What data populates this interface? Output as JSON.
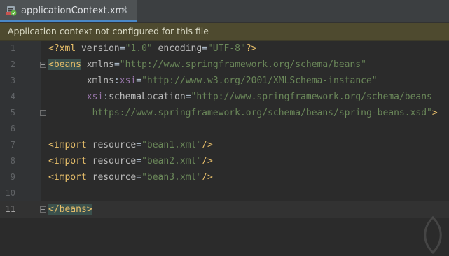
{
  "tab": {
    "label": "applicationContext.xml",
    "close": "✕"
  },
  "banner": {
    "text": "Application context not configured for this file"
  },
  "editor": {
    "current_line": 11,
    "lines": [
      {
        "num": "1"
      },
      {
        "num": "2"
      },
      {
        "num": "3"
      },
      {
        "num": "4"
      },
      {
        "num": "5"
      },
      {
        "num": "6"
      },
      {
        "num": "7"
      },
      {
        "num": "8"
      },
      {
        "num": "9"
      },
      {
        "num": "10"
      },
      {
        "num": "11"
      }
    ],
    "code": {
      "l1": {
        "open": "<?xml",
        "a1": " version",
        "eq1": "=",
        "v1": "\"1.0\"",
        "a2": " encoding",
        "eq2": "=",
        "v2": "\"UTF-8\"",
        "close": "?>"
      },
      "l2": {
        "open": "<beans",
        "a1": " xmlns",
        "eq": "=",
        "v": "\"http://www.springframework.org/schema/beans\""
      },
      "l3": {
        "indent": "       ",
        "a1": "xmlns",
        "colon": ":",
        "ns": "xsi",
        "eq": "=",
        "v": "\"http://www.w3.org/2001/XMLSchema-instance\""
      },
      "l4": {
        "indent": "       ",
        "ns": "xsi",
        "colon": ":",
        "a1": "schemaLocation",
        "eq": "=",
        "v": "\"http://www.springframework.org/schema/beans"
      },
      "l5": {
        "indent": "        ",
        "v": "https://www.springframework.org/schema/beans/spring-beans.xsd\"",
        "close": ">"
      },
      "l7": {
        "open": "<import",
        "a1": " resource",
        "eq": "=",
        "v": "\"bean1.xml\"",
        "close": "/>"
      },
      "l8": {
        "open": "<import",
        "a1": " resource",
        "eq": "=",
        "v": "\"bean2.xml\"",
        "close": "/>"
      },
      "l9": {
        "open": "<import",
        "a1": " resource",
        "eq": "=",
        "v": "\"bean3.xml\"",
        "close": "/>"
      },
      "l11": {
        "tag": "</beans",
        "close": ">"
      }
    }
  },
  "colors": {
    "tag": "#e8bf6a",
    "attribute": "#bababa",
    "namespace": "#9876aa",
    "value": "#6a8759",
    "banner_bg": "#4e4a2f"
  },
  "icons": {
    "file": "xml-file-icon",
    "close": "close-icon",
    "fold": "fold-marker-icon"
  }
}
